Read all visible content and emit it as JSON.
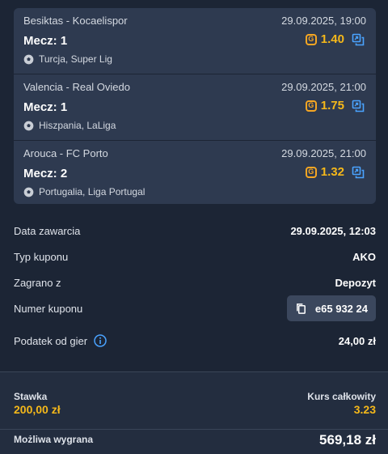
{
  "events": [
    {
      "teams": "Besiktas - Kocaelispor",
      "datetime": "29.09.2025, 19:00",
      "pick": "Mecz: 1",
      "odds": "1.40",
      "league": "Turcja, Super Lig"
    },
    {
      "teams": "Valencia - Real Oviedo",
      "datetime": "29.09.2025, 21:00",
      "pick": "Mecz: 1",
      "odds": "1.75",
      "league": "Hiszpania, LaLiga"
    },
    {
      "teams": "Arouca - FC Porto",
      "datetime": "29.09.2025, 21:00",
      "pick": "Mecz: 2",
      "odds": "1.32",
      "league": "Portugalia, Liga Portugal"
    }
  ],
  "details": {
    "date_label": "Data zawarcia",
    "date_value": "29.09.2025, 12:03",
    "type_label": "Typ kuponu",
    "type_value": "AKO",
    "played_label": "Zagrano z",
    "played_value": "Depozyt",
    "number_label": "Numer kuponu",
    "number_value": "e65 932 24",
    "tax_label": "Podatek od gier",
    "tax_value": "24,00 zł"
  },
  "summary": {
    "stake_label": "Stawka",
    "stake_value": "200,00 zł",
    "total_odds_label": "Kurs całkowity",
    "total_odds_value": "3.23",
    "win_label": "Możliwa wygrana",
    "win_value": "569,18 zł"
  },
  "colors": {
    "accent": "#f5b81a",
    "copy_icon": "#4aa3ff",
    "background": "#1c2535",
    "card": "#2e3a50"
  },
  "icons": {
    "coin": "coin-icon",
    "copy": "copy-icon",
    "football": "football-icon",
    "info": "info-icon"
  }
}
